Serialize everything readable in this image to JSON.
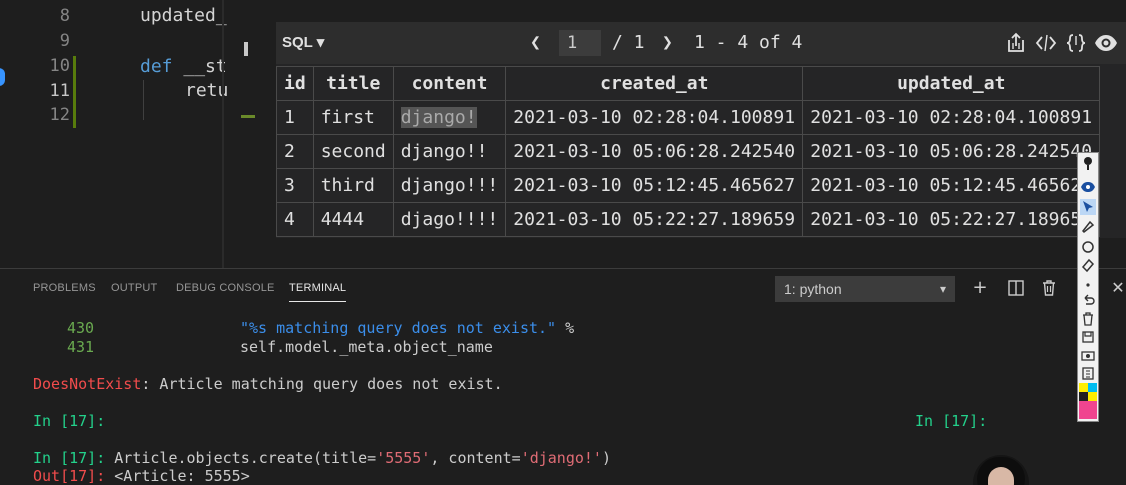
{
  "editor": {
    "line_numbers": [
      "8",
      "9",
      "10",
      "11",
      "12"
    ],
    "code": {
      "line8": "updated_",
      "line10_kw": "def",
      "line10_rest": " __st",
      "line11": "retu"
    }
  },
  "sql_viewer": {
    "mode": "SQL ▾",
    "prev": "❮",
    "page": "1",
    "page_of": "/ 1",
    "next": "❯",
    "range": "1 - 4 of 4",
    "icons": [
      "export-icon",
      "code-icon",
      "json-icon",
      "eye-icon"
    ],
    "columns": [
      "id",
      "title",
      "content",
      "created_at",
      "updated_at"
    ],
    "rows": [
      [
        "1",
        "first",
        "django!",
        "2021-03-10 02:28:04.100891",
        "2021-03-10 02:28:04.100891"
      ],
      [
        "2",
        "second",
        "django!!",
        "2021-03-10 05:06:28.242540",
        "2021-03-10 05:06:28.242540"
      ],
      [
        "3",
        "third",
        "django!!!",
        "2021-03-10 05:12:45.465627",
        "2021-03-10 05:12:45.46562"
      ],
      [
        "4",
        "4444",
        "djago!!!!",
        "2021-03-10 05:22:27.189659",
        "2021-03-10 05:22:27.18965"
      ]
    ]
  },
  "panel": {
    "tabs": [
      "PROBLEMS",
      "OUTPUT",
      "DEBUG CONSOLE",
      "TERMINAL"
    ],
    "active_tab": "TERMINAL",
    "terminal_select": "1: python",
    "icons": [
      "plus-icon",
      "split-icon",
      "trash-icon",
      "chevron-up-icon",
      "close-icon"
    ]
  },
  "terminal": {
    "l430_num": "430",
    "l430_code": "\"%s matching query does not exist.\"",
    "l430_op": " %",
    "l431_num": "431",
    "l431_code": "self.model._meta.object_name",
    "err_name": "DoesNotExist",
    "err_msg": ": Article matching query does not exist.",
    "prompt1": "In [17]:",
    "prompt1_right": "In [17]:",
    "prompt2": "In [17]:",
    "cmd_pre": " Article.objects.create(title=",
    "cmd_s1": "'5555'",
    "cmd_mid": ", content=",
    "cmd_s2": "'django!'",
    "cmd_post": ")",
    "out_label": "Out[17]:",
    "out_value": " <Article: 5555>"
  },
  "colors": {
    "accent_blue": "#3794ff",
    "terminal_green": "#23d18b",
    "terminal_red": "#f14c4c"
  }
}
